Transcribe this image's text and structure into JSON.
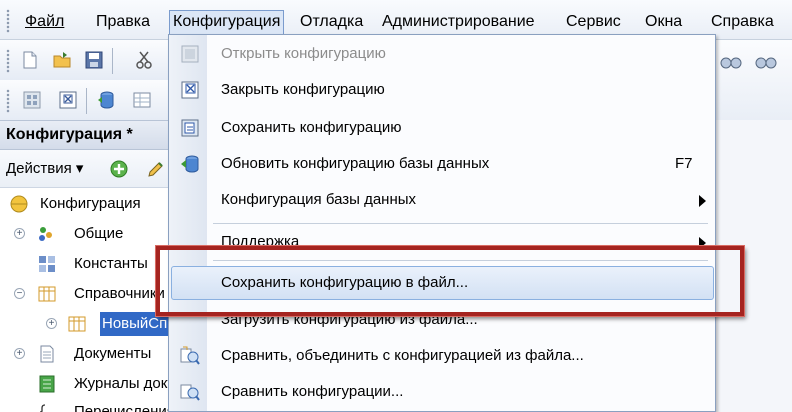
{
  "menubar": {
    "items": [
      {
        "label": "Файл",
        "active": false
      },
      {
        "label": "Правка",
        "active": false
      },
      {
        "label": "Конфигурация",
        "active": true
      },
      {
        "label": "Отладка",
        "active": false
      },
      {
        "label": "Администрирование",
        "active": false
      },
      {
        "label": "Сервис",
        "active": false
      },
      {
        "label": "Окна",
        "active": false
      },
      {
        "label": "Справка",
        "active": false
      }
    ]
  },
  "panel": {
    "title": "Конфигурация *",
    "actions_label": "Действия ▾"
  },
  "tree": {
    "root": "Конфигурация",
    "items": [
      {
        "label": "Общие",
        "expander": "+"
      },
      {
        "label": "Константы",
        "expander": ""
      },
      {
        "label": "Справочники",
        "expander": "−"
      },
      {
        "label": "НовыйСправочник",
        "expander": "+"
      },
      {
        "label": "Документы",
        "expander": "+"
      },
      {
        "label": "Журналы документов",
        "expander": ""
      },
      {
        "label": "Перечисления",
        "expander": ""
      }
    ]
  },
  "dropdown": {
    "items": [
      {
        "label": "Открыть конфигурацию",
        "disabled": true,
        "shortcut": "",
        "submenu": false,
        "icon": "open-config-icon"
      },
      {
        "label": "Закрыть конфигурацию",
        "disabled": false,
        "shortcut": "",
        "submenu": false,
        "icon": "close-config-icon"
      },
      {
        "label": "Сохранить конфигурацию",
        "disabled": false,
        "shortcut": "",
        "submenu": false,
        "icon": "save-config-icon"
      },
      {
        "label": "Обновить конфигурацию базы данных",
        "disabled": false,
        "shortcut": "F7",
        "submenu": false,
        "icon": "update-db-icon"
      },
      {
        "label": "Конфигурация базы данных",
        "disabled": false,
        "shortcut": "",
        "submenu": true,
        "icon": ""
      },
      {
        "label": "Поддержка",
        "disabled": false,
        "shortcut": "",
        "submenu": true,
        "icon": ""
      },
      {
        "label": "Сохранить конфигурацию в файл...",
        "disabled": false,
        "shortcut": "",
        "submenu": false,
        "icon": "",
        "highlighted": true
      },
      {
        "label": "Загрузить конфигурацию из файла...",
        "disabled": false,
        "shortcut": "",
        "submenu": false,
        "icon": ""
      },
      {
        "label": "Сравнить, объединить с конфигурацией из файла...",
        "disabled": false,
        "shortcut": "",
        "submenu": false,
        "icon": "compare-merge-icon"
      },
      {
        "label": "Сравнить конфигурации...",
        "disabled": false,
        "shortcut": "",
        "submenu": false,
        "icon": "compare-config-icon"
      }
    ]
  },
  "colors": {
    "callout": "#a52420",
    "selection": "#3169c6",
    "highlight": "#d3e1f4"
  }
}
